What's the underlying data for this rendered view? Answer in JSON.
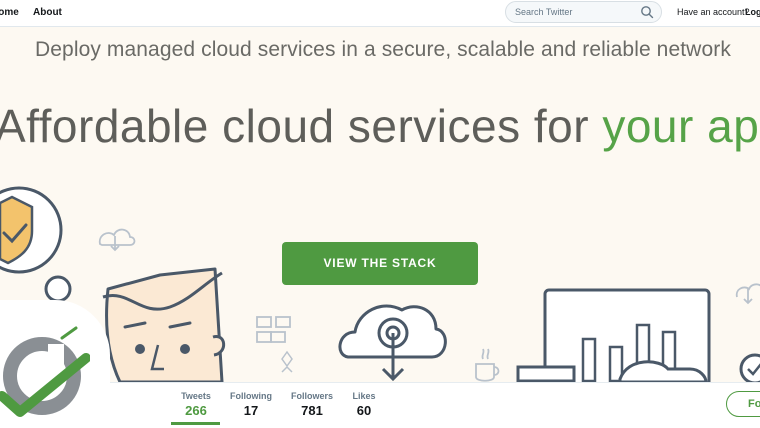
{
  "nav": {
    "home_label": "Home",
    "about_label": "About",
    "search_placeholder": "Search Twitter",
    "account_prompt": "Have an account?",
    "login_label": "Log in"
  },
  "hero": {
    "subheadline": "Deploy managed cloud services in a secure, scalable and reliable network",
    "headline_main": "Affordable cloud services for ",
    "headline_accent": "your apps",
    "cta_label": "VIEW THE STACK"
  },
  "profile_nav": {
    "tabs": [
      {
        "label": "Tweets",
        "value": "266"
      },
      {
        "label": "Following",
        "value": "17"
      },
      {
        "label": "Followers",
        "value": "781"
      },
      {
        "label": "Likes",
        "value": "60"
      }
    ],
    "follow_label": "Follow"
  },
  "icons": {
    "search": "search-icon",
    "shield": "shield-check-icon",
    "cloud_download": "cloud-download-icon",
    "cloud_upload": "cloud-upload-icon",
    "coffee": "coffee-cup-icon",
    "logo": "brand-logo"
  },
  "colors": {
    "accent_green": "#4f9a41",
    "headline_accent": "#56a348",
    "hero_background": "#fdf9f2",
    "text_gray": "#5e5e5a"
  }
}
